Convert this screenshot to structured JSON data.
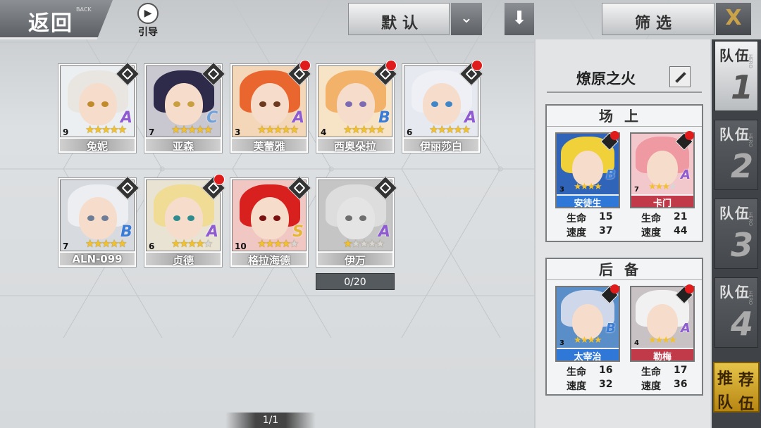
{
  "topbar": {
    "back_label": "返回",
    "back_sub": "BACK",
    "guide_label": "引导",
    "sort_label": "默认",
    "filter_label": "筛选",
    "close_label": "X"
  },
  "heroes": [
    {
      "name": "兔妮",
      "level": "9",
      "stars": 5,
      "max_stars": 5,
      "grade": "A",
      "alert": false,
      "hair": "#e9e6e2",
      "eye": "#c08a2d",
      "bg": "#eceff1"
    },
    {
      "name": "亚森",
      "level": "7",
      "stars": 5,
      "max_stars": 5,
      "grade": "C",
      "alert": false,
      "hair": "#2d2a4a",
      "eye": "#c9a040",
      "bg": "#c9c7cf"
    },
    {
      "name": "芙蕾雅",
      "level": "3",
      "stars": 5,
      "max_stars": 5,
      "grade": "A",
      "alert": true,
      "hair": "#e9672f",
      "eye": "#6b3a1f",
      "bg": "#f3d7b8"
    },
    {
      "name": "西奥朵拉",
      "level": "4",
      "stars": 5,
      "max_stars": 5,
      "grade": "B",
      "alert": true,
      "hair": "#f2b26a",
      "eye": "#7c6bb3",
      "bg": "#f7e3c6"
    },
    {
      "name": "伊丽莎白",
      "level": "6",
      "stars": 5,
      "max_stars": 5,
      "grade": "A",
      "alert": true,
      "hair": "#eef0f5",
      "eye": "#3f86c8",
      "bg": "#e7e9f1"
    },
    {
      "name": "ALN-099",
      "level": "7",
      "stars": 5,
      "max_stars": 5,
      "grade": "B",
      "alert": false,
      "hair": "#eceef2",
      "eye": "#6d7d95",
      "bg": "#d7dadf"
    },
    {
      "name": "贞德",
      "level": "6",
      "stars": 4,
      "max_stars": 5,
      "grade": "A",
      "alert": true,
      "hair": "#f0dc94",
      "eye": "#2f8c8e",
      "bg": "#e9e3d4"
    },
    {
      "name": "格拉海德",
      "level": "10",
      "stars": 4,
      "max_stars": 5,
      "grade": "S",
      "alert": false,
      "hair": "#d8201e",
      "eye": "#7a1010",
      "bg": "#f1c7c3"
    },
    {
      "name": "伊万",
      "level": "",
      "stars": 1,
      "max_stars": 5,
      "grade": "A",
      "alert": false,
      "hair": "#d8d8d8",
      "eye": "#555555",
      "bg": "#bcbcbc",
      "locked": true
    }
  ],
  "locked_progress": "0/20",
  "pager": "1/1",
  "team_panel": {
    "team_name": "燎原之火",
    "front": {
      "title": "场上",
      "members": [
        {
          "name": "安徒生",
          "level": "3",
          "stars": 4,
          "max_stars": 4,
          "grade": "B",
          "hp": "15",
          "spd": "37",
          "hair": "#f0d13a",
          "bg": "#2f64b8",
          "name_bg": "#2f78d8"
        },
        {
          "name": "卡门",
          "level": "7",
          "stars": 3,
          "max_stars": 4,
          "grade": "A",
          "hp": "21",
          "spd": "44",
          "hair": "#ef9aa2",
          "bg": "#f3c8cd",
          "name_bg": "#c03a4a"
        }
      ]
    },
    "back": {
      "title": "后备",
      "members": [
        {
          "name": "太宰治",
          "level": "3",
          "stars": 4,
          "max_stars": 4,
          "grade": "B",
          "hp": "16",
          "spd": "32",
          "hair": "#cfd8ea",
          "bg": "#5a8ec8",
          "name_bg": "#2f78d8"
        },
        {
          "name": "勒梅",
          "level": "4",
          "stars": 4,
          "max_stars": 4,
          "grade": "A",
          "hp": "17",
          "spd": "36",
          "hair": "#f1f1f1",
          "bg": "#c9c2c4",
          "name_bg": "#c03a4a"
        }
      ]
    },
    "hp_label": "生命",
    "spd_label": "速度"
  },
  "team_tabs": [
    {
      "label": "队伍",
      "number": "1",
      "active": true
    },
    {
      "label": "队伍",
      "number": "2",
      "active": false
    },
    {
      "label": "队伍",
      "number": "3",
      "active": false
    },
    {
      "label": "队伍",
      "number": "4",
      "active": false
    }
  ],
  "tab_hero_tag": "HERO",
  "recommend": {
    "chars": [
      "推",
      "荐",
      "队",
      "伍"
    ]
  }
}
